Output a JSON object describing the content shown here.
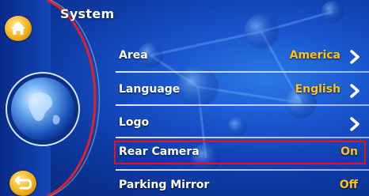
{
  "header": {
    "title": "System"
  },
  "settings": [
    {
      "label": "Area",
      "value": "America",
      "chevron": true
    },
    {
      "label": "Language",
      "value": "English",
      "chevron": true
    },
    {
      "label": "Logo",
      "value": "",
      "chevron": true
    },
    {
      "label": "Rear Camera",
      "value": "On",
      "chevron": false,
      "selected": true
    },
    {
      "label": "Parking Mirror",
      "value": "Off",
      "chevron": false
    }
  ],
  "icons": {
    "home": "home-icon",
    "back": "back-icon",
    "category": "globe-icon",
    "next": "chevron-right-icon"
  },
  "colors": {
    "value": "#ffc21a",
    "selection": "#e4141e",
    "text": "#ffffff",
    "accent": "#f2b21c"
  }
}
